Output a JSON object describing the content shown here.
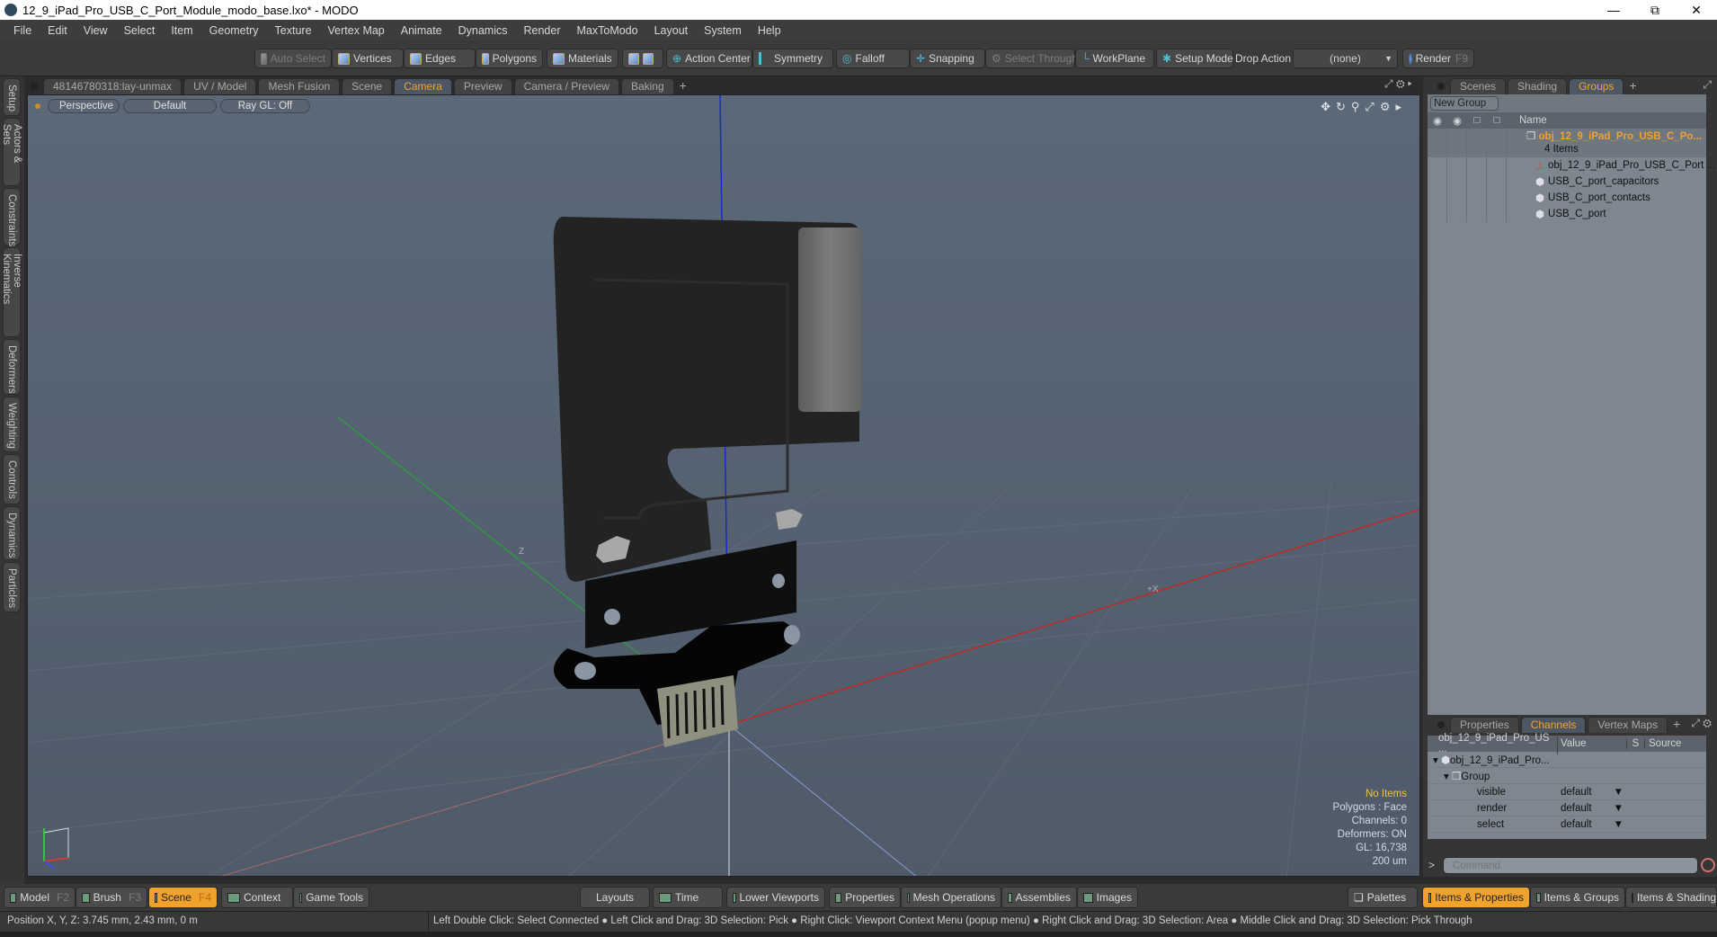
{
  "window": {
    "title": "12_9_iPad_Pro_USB_C_Port_Module_modo_base.lxo* - MODO",
    "controls": [
      "minimize",
      "restore",
      "close"
    ]
  },
  "menu": [
    "File",
    "Edit",
    "View",
    "Select",
    "Item",
    "Geometry",
    "Texture",
    "Vertex Map",
    "Animate",
    "Dynamics",
    "Render",
    "MaxToModo",
    "Layout",
    "System",
    "Help"
  ],
  "toolbar": {
    "auto_select": "Auto Select",
    "vertices": "Vertices",
    "edges": "Edges",
    "polygons": "Polygons",
    "materials": "Materials",
    "action_center": "Action Center",
    "symmetry": "Symmetry",
    "falloff": "Falloff",
    "snapping": "Snapping",
    "select_through": "Select Through",
    "workplane": "WorkPlane",
    "setup_mode": "Setup Mode",
    "drop_action_label": "Drop Action",
    "drop_action_value": "(none)",
    "render": "Render",
    "render_key": "F9"
  },
  "left_tabs": [
    "Setup",
    "Actors & Sets",
    "Constraints",
    "Inverse Kinematics",
    "Deformers",
    "Weighting",
    "Controls",
    "Dynamics",
    "Particles"
  ],
  "viewport_tabs": [
    "48146780318:lay-unmax",
    "UV / Model",
    "Mesh Fusion",
    "Scene",
    "Camera",
    "Preview",
    "Camera / Preview",
    "Baking"
  ],
  "viewport_tabs_active": "Camera",
  "viewport": {
    "view": "Perspective",
    "shading": "Default",
    "raygl": "Ray GL: Off",
    "axis_label_x": "+X",
    "axis_label_z": "Z",
    "hud": {
      "selection": "No Items",
      "polygons": "Polygons : Face",
      "channels": "Channels: 0",
      "deformers": "Deformers: ON",
      "gl": "GL: 16,738",
      "scale": "200 um"
    }
  },
  "right_tabs": [
    "Scenes",
    "Shading",
    "Groups"
  ],
  "right_tabs_active": "Groups",
  "groups": {
    "new_group": "New Group",
    "name_header": "Name",
    "root": {
      "name": "obj_12_9_iPad_Pro_USB_C_Po...",
      "count": "4 Items"
    },
    "items": [
      {
        "name": "obj_12_9_iPad_Pro_USB_C_Port ...",
        "icon": "locator-icon"
      },
      {
        "name": "USB_C_port_capacitors",
        "icon": "mesh-icon"
      },
      {
        "name": "USB_C_port_contacts",
        "icon": "mesh-icon"
      },
      {
        "name": "USB_C_port",
        "icon": "mesh-icon"
      }
    ]
  },
  "lower_tabs": [
    "Properties",
    "Channels",
    "Vertex Maps"
  ],
  "lower_tabs_active": "Channels",
  "channels": {
    "headers": [
      "obj_12_9_iPad_Pro_US ...",
      "Value",
      "S",
      "Source"
    ],
    "tree_root": "obj_12_9_iPad_Pro...",
    "group": "Group",
    "rows": [
      {
        "name": "visible",
        "value": "default"
      },
      {
        "name": "render",
        "value": "default"
      },
      {
        "name": "select",
        "value": "default"
      }
    ]
  },
  "command": {
    "prompt": ">",
    "placeholder": "Command"
  },
  "bottom_layouts": [
    {
      "label": "Model",
      "key": "F2"
    },
    {
      "label": "Brush",
      "key": "F3"
    },
    {
      "label": "Scene",
      "key": "F4",
      "active": true
    },
    {
      "label": "Context"
    },
    {
      "label": "Game Tools"
    }
  ],
  "bottom_center": [
    "Layouts",
    "Time",
    "Lower Viewports",
    "Properties",
    "Mesh Operations",
    "Assemblies",
    "Images"
  ],
  "bottom_right": [
    "Palettes",
    "Items & Properties",
    "Items & Groups",
    "Items & Shading"
  ],
  "bottom_right_active": "Items & Properties",
  "status": {
    "position": "Position X, Y, Z:   3.745 mm, 2.43 mm, 0 m",
    "hints": "Left Double Click: Select Connected ● Left Click and Drag: 3D Selection: Pick ● Right Click: Viewport Context Menu (popup menu) ● Right Click and Drag: 3D Selection: Area ● Middle Click and Drag: 3D Selection: Pick Through"
  }
}
